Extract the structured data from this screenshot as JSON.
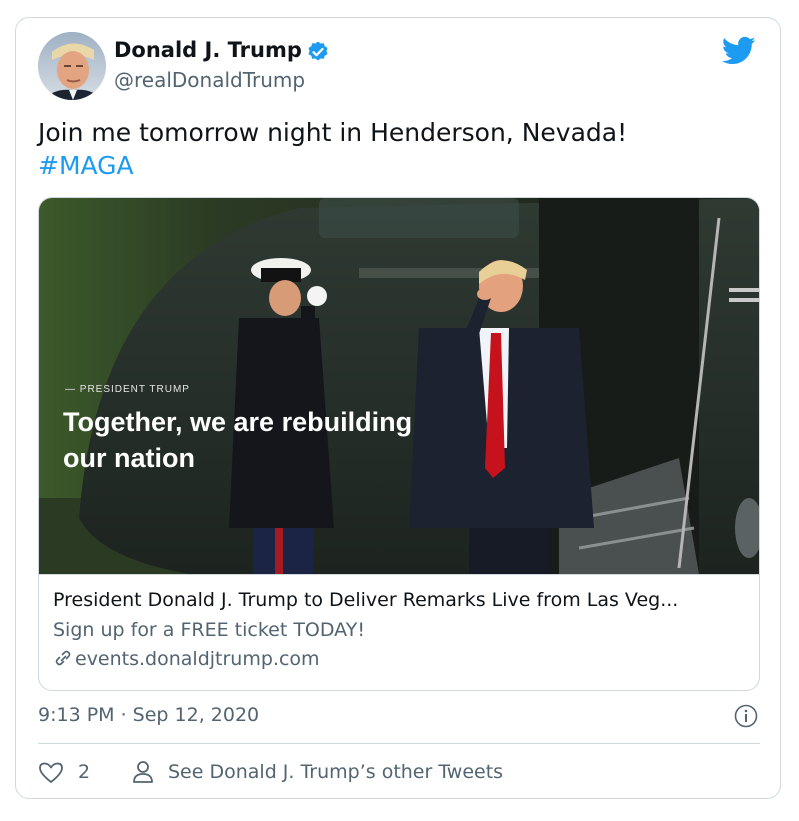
{
  "author": {
    "display_name": "Donald J. Trump",
    "handle": "@realDonaldTrump",
    "verified": true,
    "avatar": "author-avatar"
  },
  "brand_icon": "twitter-bird-icon",
  "tweet": {
    "text": "Join me tomorrow night in Henderson, Nevada!",
    "hashtag": "#MAGA"
  },
  "link_card": {
    "image_eyebrow": "— PRESIDENT TRUMP",
    "image_headline": "Together, we are rebuilding our nation",
    "title": "President Donald J. Trump to Deliver Remarks Live from Las Veg...",
    "description": "Sign up for a FREE ticket TODAY!",
    "domain": "events.donaldjtrump.com",
    "domain_icon": "link-icon"
  },
  "meta": {
    "timestamp": "9:13 PM · Sep 12, 2020",
    "info_icon": "info-icon"
  },
  "actions": {
    "like_count": "2",
    "like_icon": "heart-icon",
    "other_tweets_label": "See Donald J. Trump’s other Tweets",
    "other_tweets_icon": "person-icon"
  },
  "colors": {
    "accent": "#1d9bf0",
    "text_primary": "#0f1419",
    "text_secondary": "#536471",
    "border": "#cfd9de"
  }
}
